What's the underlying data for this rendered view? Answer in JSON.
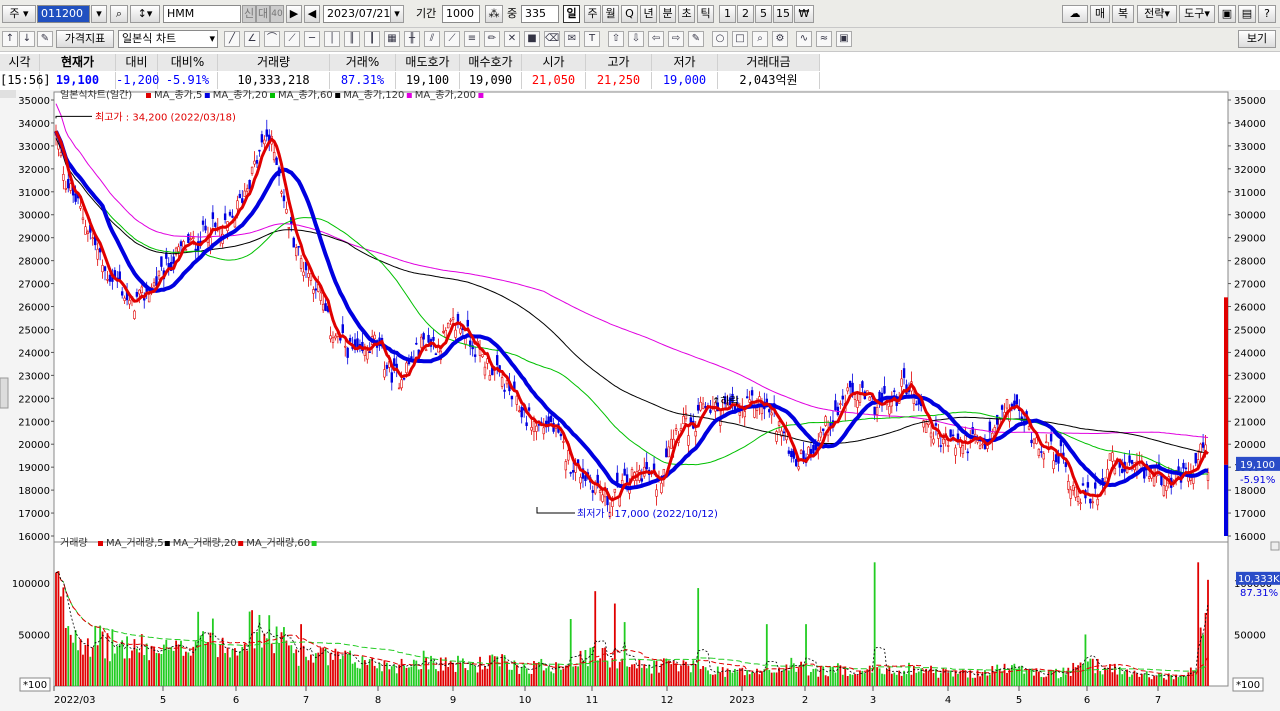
{
  "toolbar1": {
    "market_label": "주",
    "code": "011200",
    "name": "HMM",
    "badges": [
      "신",
      "대",
      "40"
    ],
    "date": "2023/07/21",
    "period_label": "기간",
    "period_value": "1000",
    "count_label": "중",
    "count_value": "335",
    "periods": [
      "일",
      "주",
      "월",
      "Q",
      "년",
      "분",
      "초",
      "틱",
      "1",
      "2",
      "5",
      "15",
      "₩"
    ],
    "right_buttons": [
      "매",
      "복",
      "전략",
      "도구"
    ]
  },
  "toolbar2": {
    "indicator_button": "가격지표",
    "chart_type": "일본식 차트",
    "view_button": "보기"
  },
  "quote": {
    "headers": [
      "시각",
      "현재가",
      "대비",
      "대비%",
      "거래량",
      "거래%",
      "매도호가",
      "매수호가",
      "시가",
      "고가",
      "저가",
      "거래대금"
    ],
    "values": [
      "[15:56]",
      "19,100",
      "-1,200",
      "-5.91%",
      "10,333,218",
      "87.31%",
      "19,100",
      "19,090",
      "21,050",
      "21,250",
      "19,000",
      "2,043억원"
    ],
    "colors": [
      "#000000",
      "#0000ff",
      "#0000ff",
      "#0000ff",
      "#000000",
      "#0000ff",
      "#000000",
      "#000000",
      "#ff0000",
      "#ff0000",
      "#0000ff",
      "#000000"
    ]
  },
  "chart_data": {
    "type": "candlestick",
    "legend_price": "일본식차트(일간)",
    "price_ma": [
      {
        "name": "MA_종가,5",
        "color": "#e00000"
      },
      {
        "name": "MA_종가,20",
        "color": "#0000e0"
      },
      {
        "name": "MA_종가,60",
        "color": "#00c000"
      },
      {
        "name": "MA_종가,120",
        "color": "#000000"
      },
      {
        "name": "MA_종가,200",
        "color": "#e000e0"
      }
    ],
    "legend_volume": "거래량",
    "volume_ma": [
      {
        "name": "MA_거래량,5",
        "color": "#e00000"
      },
      {
        "name": "MA_거래량,20",
        "color": "#000000"
      },
      {
        "name": "MA_거래량,60",
        "color": "#e00000"
      }
    ],
    "price_ylim": [
      16000,
      35000
    ],
    "price_ticks": [
      35000,
      34000,
      33000,
      32000,
      31000,
      30000,
      29000,
      28000,
      27000,
      26000,
      25000,
      24000,
      23000,
      22000,
      21000,
      20000,
      19000,
      18000,
      17000,
      16000
    ],
    "volume_ticks": [
      100000,
      50000
    ],
    "volume_ylim": [
      0,
      130000
    ],
    "volume_unit": "*100",
    "x_labels": [
      "2022/03",
      "5",
      "6",
      "7",
      "8",
      "9",
      "10",
      "11",
      "12",
      "2023",
      "2",
      "3",
      "4",
      "5",
      "6",
      "7"
    ],
    "high_annotation": "최고가 : 34,200 (2022/03/18)",
    "low_annotation": "최저가 : 17,000 (2022/10/12)",
    "extra_annotation": "↑하락",
    "current_price_label": "19,100",
    "current_change_label": "-5.91%",
    "current_volume_label": "10,333K",
    "current_volume_pct": "87.31%",
    "close_anchors": [
      [
        0,
        33500
      ],
      [
        4,
        31500
      ],
      [
        10,
        30200
      ],
      [
        16,
        28700
      ],
      [
        20,
        27500
      ],
      [
        26,
        27000
      ],
      [
        30,
        26000
      ],
      [
        36,
        26500
      ],
      [
        42,
        27200
      ],
      [
        46,
        27800
      ],
      [
        52,
        28600
      ],
      [
        58,
        28800
      ],
      [
        62,
        29500
      ],
      [
        68,
        29200
      ],
      [
        72,
        29800
      ],
      [
        80,
        31800
      ],
      [
        86,
        33500
      ],
      [
        90,
        32500
      ],
      [
        94,
        30000
      ],
      [
        100,
        28000
      ],
      [
        106,
        27000
      ],
      [
        112,
        25000
      ],
      [
        118,
        24300
      ],
      [
        124,
        23800
      ],
      [
        130,
        24500
      ],
      [
        136,
        23200
      ],
      [
        140,
        22900
      ],
      [
        146,
        23800
      ],
      [
        150,
        24500
      ],
      [
        156,
        24300
      ],
      [
        162,
        25200
      ],
      [
        166,
        25100
      ],
      [
        170,
        24400
      ],
      [
        176,
        23500
      ],
      [
        182,
        22800
      ],
      [
        188,
        21700
      ],
      [
        192,
        21200
      ],
      [
        196,
        20800
      ],
      [
        202,
        20900
      ],
      [
        206,
        20000
      ],
      [
        210,
        19200
      ],
      [
        216,
        18600
      ],
      [
        222,
        18000
      ],
      [
        226,
        17400
      ],
      [
        230,
        18100
      ],
      [
        236,
        18600
      ],
      [
        240,
        18900
      ],
      [
        246,
        18200
      ],
      [
        250,
        20200
      ],
      [
        256,
        21100
      ],
      [
        260,
        20300
      ],
      [
        264,
        21800
      ],
      [
        268,
        21500
      ],
      [
        274,
        21600
      ],
      [
        280,
        21400
      ],
      [
        286,
        21900
      ],
      [
        290,
        21600
      ],
      [
        294,
        21000
      ],
      [
        298,
        20200
      ],
      [
        302,
        19300
      ],
      [
        306,
        19500
      ],
      [
        310,
        20100
      ],
      [
        314,
        20800
      ],
      [
        318,
        21300
      ],
      [
        322,
        22000
      ],
      [
        326,
        22200
      ],
      [
        330,
        22000
      ],
      [
        334,
        21700
      ],
      [
        338,
        21800
      ],
      [
        342,
        21900
      ],
      [
        346,
        22700
      ],
      [
        350,
        22300
      ],
      [
        354,
        21200
      ],
      [
        358,
        20500
      ],
      [
        362,
        20200
      ],
      [
        366,
        20100
      ],
      [
        370,
        20000
      ],
      [
        374,
        20200
      ],
      [
        378,
        19800
      ],
      [
        382,
        20400
      ],
      [
        386,
        21200
      ],
      [
        390,
        21800
      ],
      [
        394,
        21100
      ],
      [
        398,
        20500
      ],
      [
        402,
        20000
      ],
      [
        406,
        19700
      ],
      [
        410,
        19500
      ],
      [
        414,
        18300
      ],
      [
        418,
        17900
      ],
      [
        422,
        17600
      ],
      [
        426,
        18200
      ],
      [
        430,
        19300
      ],
      [
        434,
        18900
      ],
      [
        438,
        18800
      ],
      [
        442,
        18900
      ],
      [
        446,
        18700
      ],
      [
        450,
        18700
      ],
      [
        454,
        18500
      ],
      [
        458,
        18400
      ],
      [
        462,
        18700
      ],
      [
        466,
        19000
      ],
      [
        468,
        20300
      ],
      [
        470,
        19100
      ]
    ],
    "volume_anchors": [
      [
        0,
        95000
      ],
      [
        6,
        55000
      ],
      [
        12,
        48000
      ],
      [
        20,
        40000
      ],
      [
        30,
        38000
      ],
      [
        40,
        35000
      ],
      [
        50,
        33000
      ],
      [
        60,
        52000
      ],
      [
        70,
        40000
      ],
      [
        80,
        55000
      ],
      [
        90,
        48000
      ],
      [
        100,
        30000
      ],
      [
        110,
        28000
      ],
      [
        120,
        25000
      ],
      [
        130,
        22000
      ],
      [
        140,
        20000
      ],
      [
        150,
        26000
      ],
      [
        160,
        22000
      ],
      [
        170,
        20000
      ],
      [
        180,
        24000
      ],
      [
        190,
        18000
      ],
      [
        200,
        20000
      ],
      [
        210,
        22000
      ],
      [
        220,
        30000
      ],
      [
        230,
        25000
      ],
      [
        240,
        18000
      ],
      [
        250,
        22000
      ],
      [
        260,
        18000
      ],
      [
        270,
        15000
      ],
      [
        280,
        14000
      ],
      [
        290,
        13000
      ],
      [
        300,
        20000
      ],
      [
        310,
        14000
      ],
      [
        320,
        16000
      ],
      [
        330,
        15000
      ],
      [
        340,
        14000
      ],
      [
        350,
        18000
      ],
      [
        360,
        13000
      ],
      [
        370,
        12000
      ],
      [
        380,
        14000
      ],
      [
        390,
        18000
      ],
      [
        400,
        13000
      ],
      [
        410,
        12000
      ],
      [
        420,
        20000
      ],
      [
        430,
        18000
      ],
      [
        440,
        12000
      ],
      [
        450,
        10000
      ],
      [
        460,
        9000
      ],
      [
        466,
        20000
      ],
      [
        470,
        103000
      ]
    ],
    "volume_spikes": [
      [
        0,
        110000
      ],
      [
        58,
        72000
      ],
      [
        100,
        60000
      ],
      [
        210,
        65000
      ],
      [
        220,
        92000
      ],
      [
        228,
        80000
      ],
      [
        232,
        62000
      ],
      [
        262,
        95000
      ],
      [
        290,
        60000
      ],
      [
        306,
        60000
      ],
      [
        334,
        120000
      ],
      [
        420,
        50000
      ],
      [
        466,
        120000
      ],
      [
        470,
        103000
      ]
    ]
  }
}
